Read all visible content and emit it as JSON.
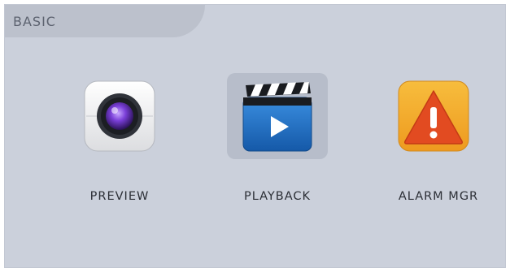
{
  "section": {
    "title": "BASIC"
  },
  "tiles": [
    {
      "label": "PREVIEW",
      "icon": "camera-icon",
      "selected": false
    },
    {
      "label": "PLAYBACK",
      "icon": "video-clapper-icon",
      "selected": true
    },
    {
      "label": "ALARM MGR",
      "icon": "warning-icon",
      "selected": false
    }
  ],
  "colors": {
    "panel_bg": "#cbd0db",
    "tab_bg": "#bcc1cc",
    "selected_tile": "#b7bdca",
    "playback_blue": "#1f70c4",
    "alarm_orange": "#f2a52a",
    "alarm_red": "#e24b21"
  }
}
